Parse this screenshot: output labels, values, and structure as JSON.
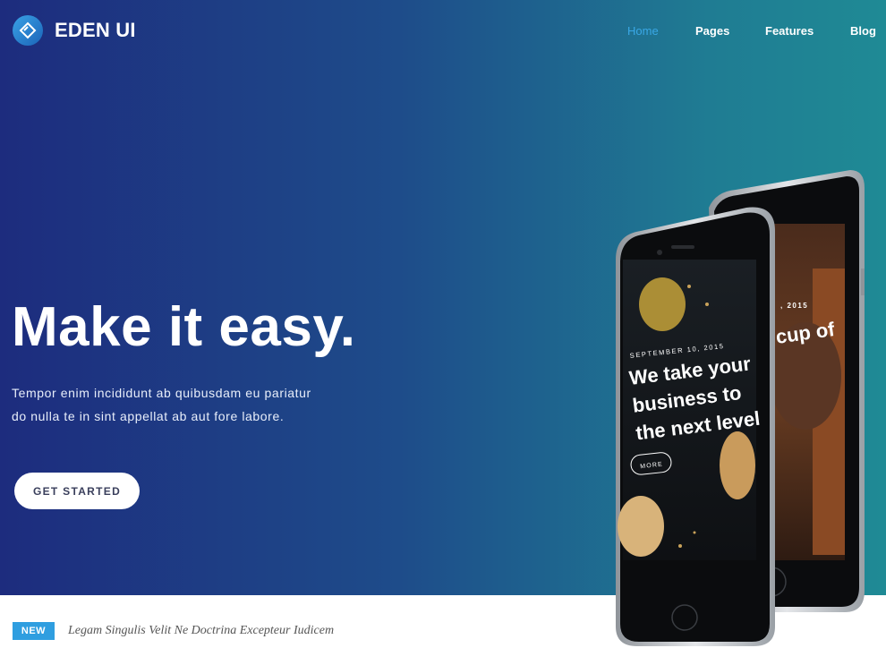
{
  "brand": {
    "name": "EDEN UI",
    "logo_icon": "diamond-link-icon"
  },
  "nav": {
    "items": [
      {
        "label": "Home",
        "active": true
      },
      {
        "label": "Pages",
        "active": false
      },
      {
        "label": "Features",
        "active": false
      },
      {
        "label": "Blog",
        "active": false
      }
    ]
  },
  "hero": {
    "headline": "Make it easy.",
    "lead": "Tempor enim incididunt ab quibusdam eu pariatur do nulla te in sint appellat ab aut fore labore.",
    "cta_label": "GET STARTED"
  },
  "phone_front": {
    "date": "SEPTEMBER 10, 2015",
    "title_line1": "We take your",
    "title_line2": "business to",
    "title_line3": "the next level",
    "more_label": "MORE"
  },
  "phone_back": {
    "date_fragment": ", 2015",
    "title_fragment": "cup of"
  },
  "news": {
    "badge": "NEW",
    "text": "Legam Singulis Velit Ne Doctrina Excepteur Iudicem"
  },
  "colors": {
    "gradient_start": "#1d2c7e",
    "gradient_end": "#1f8a95",
    "accent": "#2f9ee0",
    "nav_active": "#3aa8e6"
  }
}
